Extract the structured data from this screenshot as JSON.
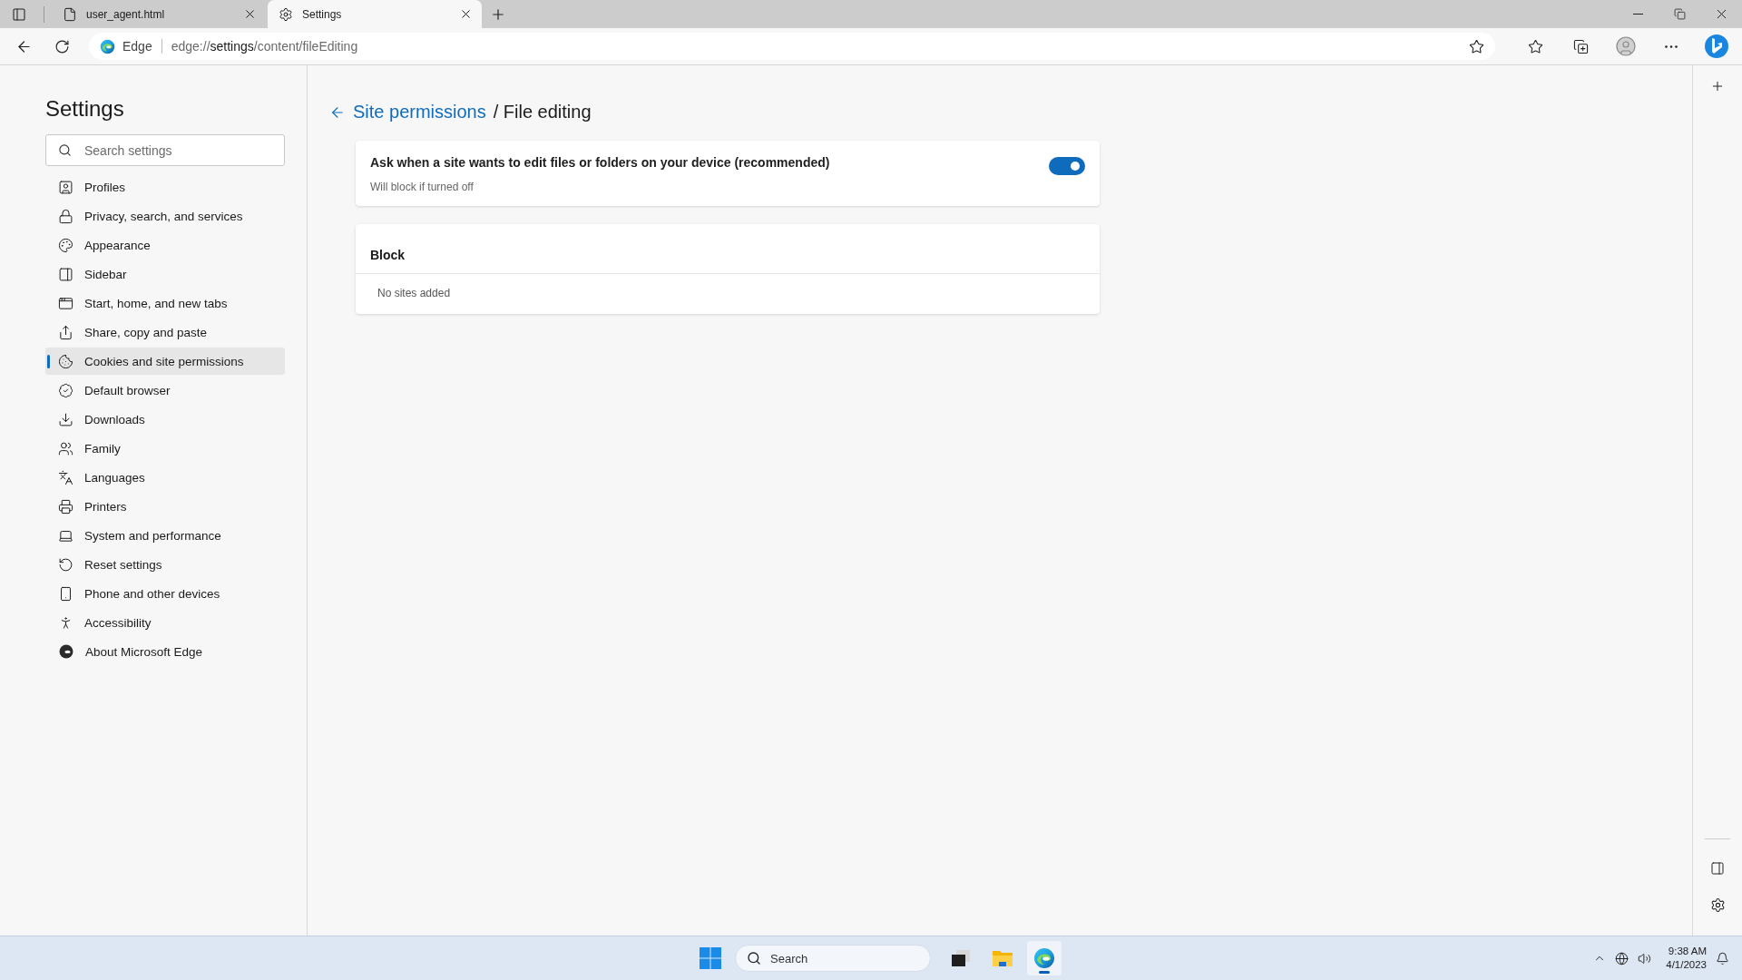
{
  "browser_tabs": [
    {
      "title": "user_agent.html",
      "selected": false
    },
    {
      "title": "Settings",
      "selected": true
    }
  ],
  "address_bar": {
    "site_label": "Edge",
    "url_scheme": "edge://",
    "url_host": "settings",
    "url_path": "/content/fileEditing"
  },
  "sidebar": {
    "title": "Settings",
    "search": {
      "placeholder": "Search settings"
    },
    "items": [
      {
        "label": "Profiles",
        "selected": false
      },
      {
        "label": "Privacy, search, and services",
        "selected": false
      },
      {
        "label": "Appearance",
        "selected": false
      },
      {
        "label": "Sidebar",
        "selected": false
      },
      {
        "label": "Start, home, and new tabs",
        "selected": false
      },
      {
        "label": "Share, copy and paste",
        "selected": false
      },
      {
        "label": "Cookies and site permissions",
        "selected": true
      },
      {
        "label": "Default browser",
        "selected": false
      },
      {
        "label": "Downloads",
        "selected": false
      },
      {
        "label": "Family",
        "selected": false
      },
      {
        "label": "Languages",
        "selected": false
      },
      {
        "label": "Printers",
        "selected": false
      },
      {
        "label": "System and performance",
        "selected": false
      },
      {
        "label": "Reset settings",
        "selected": false
      },
      {
        "label": "Phone and other devices",
        "selected": false
      },
      {
        "label": "Accessibility",
        "selected": false
      },
      {
        "label": "About Microsoft Edge",
        "selected": false
      }
    ]
  },
  "page": {
    "breadcrumb_link": "Site permissions",
    "title": "/ File editing"
  },
  "toggle_card": {
    "label": "Ask when a site wants to edit files or folders on your device (recommended)",
    "description": "Will block if turned off",
    "on": true
  },
  "block_card": {
    "title": "Block",
    "empty_text": "No sites added"
  },
  "taskbar": {
    "search_placeholder": "Search",
    "apps": [
      {
        "kind": "terminal",
        "selected": false
      },
      {
        "kind": "folder",
        "selected": false
      },
      {
        "kind": "edge",
        "selected": true
      }
    ]
  },
  "tray": {
    "time": "9:38 AM",
    "date": "4/1/2023"
  }
}
